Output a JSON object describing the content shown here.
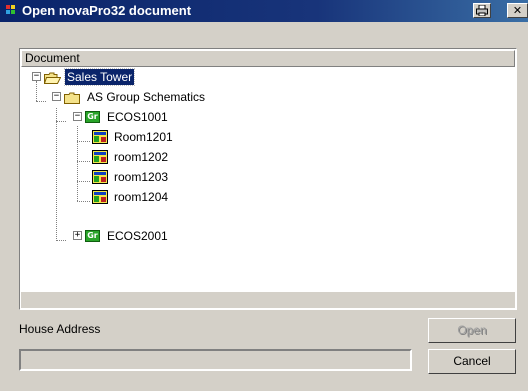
{
  "window": {
    "title": "Open novaPro32 document"
  },
  "tree": {
    "header": "Document",
    "nodes": [
      {
        "label": "Sales Tower",
        "icon": "open-folder-icon",
        "selected": true
      },
      {
        "label": "AS Group Schematics",
        "icon": "folder-icon"
      },
      {
        "label": "ECOS1001",
        "icon": "group-icon",
        "badge": "Gr"
      },
      {
        "label": "Room1201",
        "icon": "room-schematic-icon"
      },
      {
        "label": "room1202",
        "icon": "room-schematic-icon"
      },
      {
        "label": "room1203",
        "icon": "room-schematic-icon"
      },
      {
        "label": "room1204",
        "icon": "room-schematic-icon"
      },
      {
        "label": "ECOS2001",
        "icon": "group-icon",
        "badge": "Gr"
      }
    ]
  },
  "house_address": {
    "label": "House Address",
    "value": ""
  },
  "buttons": {
    "open": "Open",
    "cancel": "Cancel"
  },
  "colors": {
    "titlebar": "#0a246a",
    "selection": "#0a246a",
    "face": "#d4d0c8"
  }
}
